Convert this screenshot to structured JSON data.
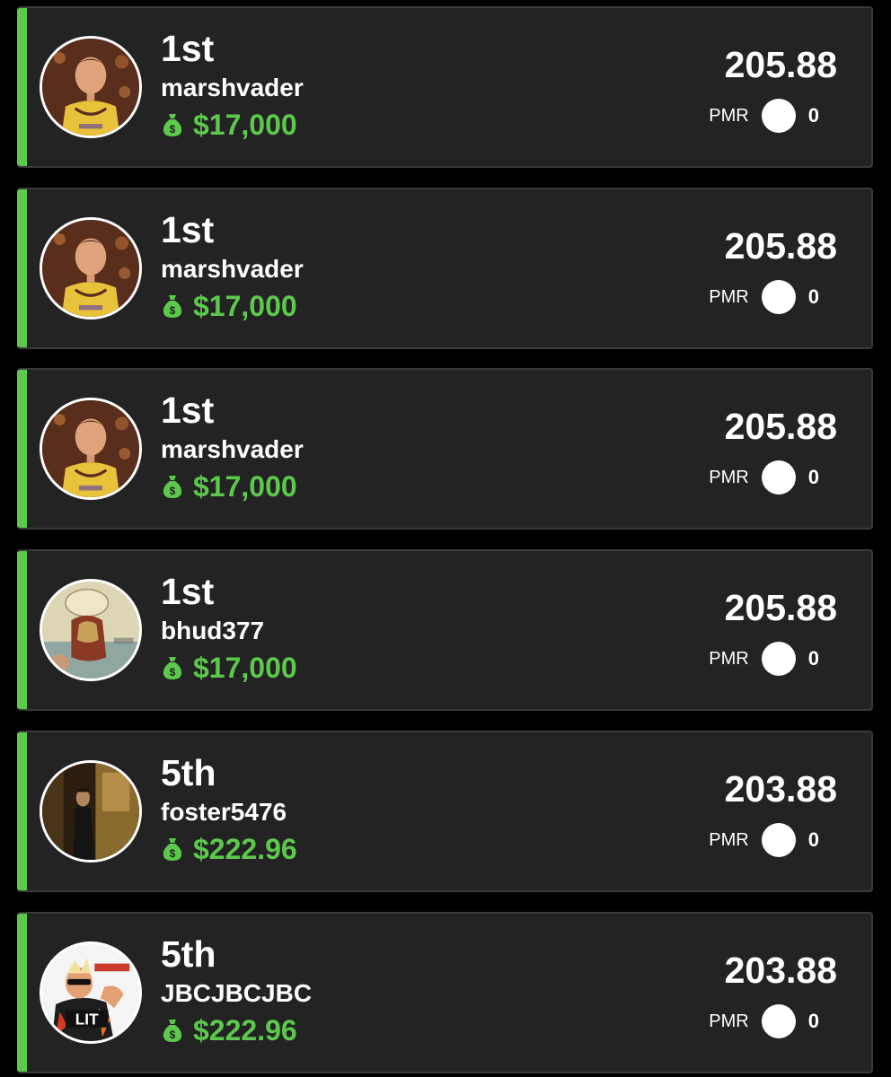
{
  "colors": {
    "background": "#000000",
    "card": "#232323",
    "accent": "#5cc94c",
    "winnings_text": "#5cc94c",
    "text": "#ffffff"
  },
  "entries": [
    {
      "rank": "1st",
      "username": "marshvader",
      "winnings": "$17,000",
      "score": "205.88",
      "pmr_label": "PMR",
      "pmr_value": "0",
      "avatar": "player-in-yellow-jersey"
    },
    {
      "rank": "1st",
      "username": "marshvader",
      "winnings": "$17,000",
      "score": "205.88",
      "pmr_label": "PMR",
      "pmr_value": "0",
      "avatar": "player-in-yellow-jersey"
    },
    {
      "rank": "1st",
      "username": "marshvader",
      "winnings": "$17,000",
      "score": "205.88",
      "pmr_label": "PMR",
      "pmr_value": "0",
      "avatar": "player-in-yellow-jersey"
    },
    {
      "rank": "1st",
      "username": "bhud377",
      "winnings": "$17,000",
      "score": "205.88",
      "pmr_label": "PMR",
      "pmr_value": "0",
      "avatar": "painted-figure-with-hat"
    },
    {
      "rank": "5th",
      "username": "foster5476",
      "winnings": "$222.96",
      "score": "203.88",
      "pmr_label": "PMR",
      "pmr_value": "0",
      "avatar": "man-in-dark-coat"
    },
    {
      "rank": "5th",
      "username": "JBCJBCJBC",
      "winnings": "$222.96",
      "score": "203.88",
      "pmr_label": "PMR",
      "pmr_value": "0",
      "avatar": "lit-meme"
    }
  ]
}
